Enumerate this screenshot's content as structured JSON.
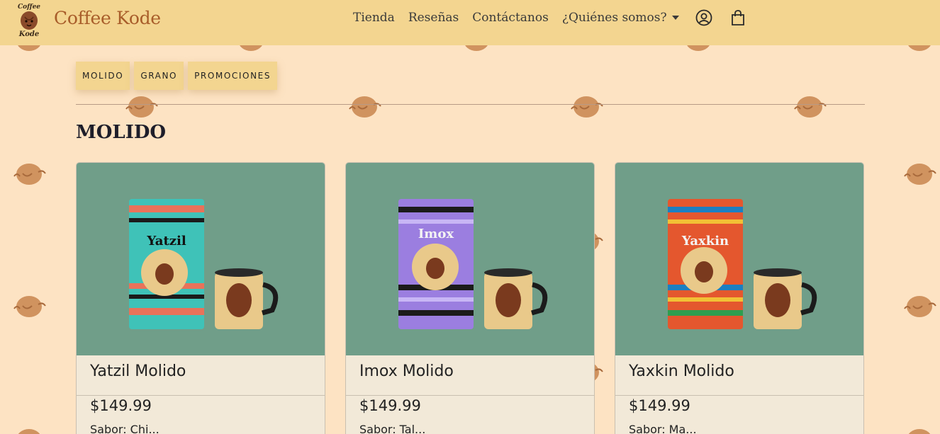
{
  "brand": {
    "name": "Coffee Kode",
    "logo_text_top": "Coffee",
    "logo_text_bottom": "Kode"
  },
  "nav": {
    "links": [
      "Tienda",
      "Reseñas",
      "Contáctanos",
      "¿Quiénes somos?"
    ],
    "icons": [
      "user-icon",
      "shopping-bag-icon"
    ]
  },
  "categories": [
    "MOLIDO",
    "GRANO",
    "PROMOCIONES"
  ],
  "section": {
    "title": "MOLIDO"
  },
  "products": [
    {
      "name": "Yatzil Molido",
      "price": "$149.99",
      "bag_label": "Yatzil",
      "extra": "Sabor: Chi..."
    },
    {
      "name": "Imox Molido",
      "price": "$149.99",
      "bag_label": "Imox",
      "extra": "Sabor: Tal..."
    },
    {
      "name": "Yaxkin Molido",
      "price": "$149.99",
      "bag_label": "Yaxkin",
      "extra": "Sabor: Ma..."
    }
  ],
  "colors": {
    "page_bg": "#fde3c3",
    "navbar_bg": "#f3d590",
    "brand_text": "#a85d2a",
    "card_image_bg": "#709e89",
    "card_bg": "#f2e9d8"
  }
}
